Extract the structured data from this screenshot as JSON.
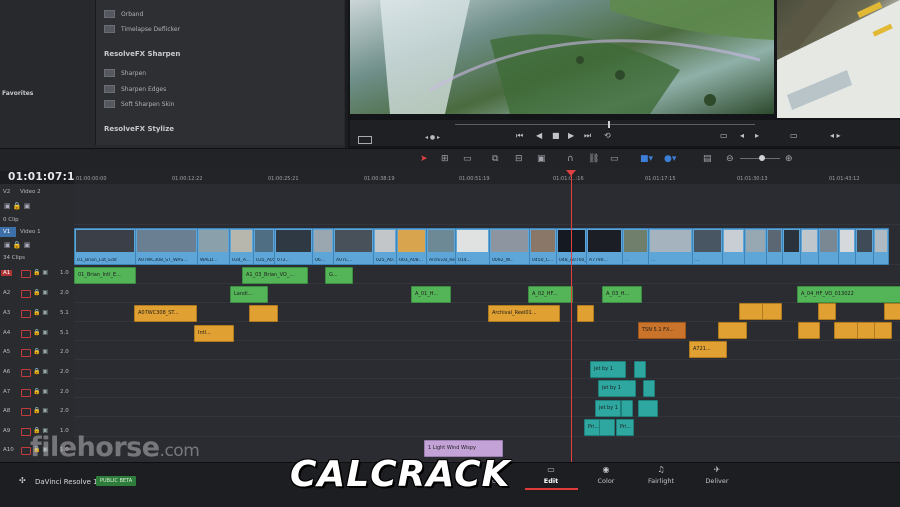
{
  "effects": {
    "favorites_label": "Favorites",
    "items_top": [
      "Orband",
      "Timelapse Deflicker"
    ],
    "sharpen_header": "ResolveFX Sharpen",
    "sharpen_items": [
      "Sharpen",
      "Sharpen Edges",
      "Soft Sharpen Skin"
    ],
    "stylize_header": "ResolveFX Stylize"
  },
  "timeline": {
    "timecode": "01:01:07:19",
    "ruler": [
      "01:00:00:00",
      "01:00:12:22",
      "01:00:25:21",
      "01:00:38:19",
      "01:00:51:19",
      "01:01:0‥:16",
      "01:01:17:15",
      "01:01:30:13",
      "01:01:43:12"
    ],
    "video_tracks": [
      {
        "id": "V2",
        "name": "Video 2",
        "clips": "0 Clip"
      },
      {
        "id": "V1",
        "name": "Video 1",
        "clips": "34 Clips"
      }
    ],
    "audio_tracks": [
      {
        "id": "A1",
        "val": "1.0"
      },
      {
        "id": "A2",
        "val": "2.0"
      },
      {
        "id": "A3",
        "val": "5.1"
      },
      {
        "id": "A4",
        "val": "5.1"
      },
      {
        "id": "A5",
        "val": "2.0"
      },
      {
        "id": "A6",
        "val": "2.0"
      },
      {
        "id": "A7",
        "val": "2.0"
      },
      {
        "id": "A8",
        "val": "2.0"
      },
      {
        "id": "A9",
        "val": "1.0"
      },
      {
        "id": "A10",
        "val": "1.0"
      }
    ],
    "video_clips": [
      "01_Brian_Lot_Edit",
      "A07WC308_ST_WAS...",
      "WALD...",
      "034_A...",
      "035_A0586...",
      "072...",
      "06...",
      "A07C...",
      "025_A0...",
      "003_A08...",
      "Archival_Reel01...",
      "014...",
      "0092_W...",
      "0450_C...",
      "048_A0700_0...",
      "A7790...",
      "...",
      "...",
      "..."
    ],
    "audio_clips": {
      "a1_1": "01_Brian_Intl_E...",
      "a1_2": "A1_03_Brian_VO_...",
      "a1_3": "G...",
      "a2_1": "Landi...",
      "a2_2": "A_01_H...",
      "a2_3": "A_02_HF...",
      "a2_4": "A_03_H...",
      "a2_5": "A_04_HF_VO_013022",
      "a3_1": "A07WC308_ST...",
      "a3_2": "Archival_Reel01...",
      "a4_1": "Intl...",
      "a4_2": "TSN 5.1 FX...",
      "a5_1": "A721...",
      "a6_1": "jet by 1",
      "a7_1": "jet by 1",
      "a8_1": "jet by 1",
      "a9_1": "Pri...",
      "a9_2": "Pri...",
      "a10_1": "1 Light Wind Wispy"
    }
  },
  "bottom": {
    "app_name": "DaVinci Resolve 14",
    "badge": "PUBLIC BETA",
    "pages": [
      "dia",
      "Edit",
      "Color",
      "Fairlight",
      "Deliver"
    ],
    "active_page": "Edit"
  },
  "watermark": {
    "main": "filehorse",
    "suffix": ".com"
  },
  "overlay_text": "CALCRACK"
}
